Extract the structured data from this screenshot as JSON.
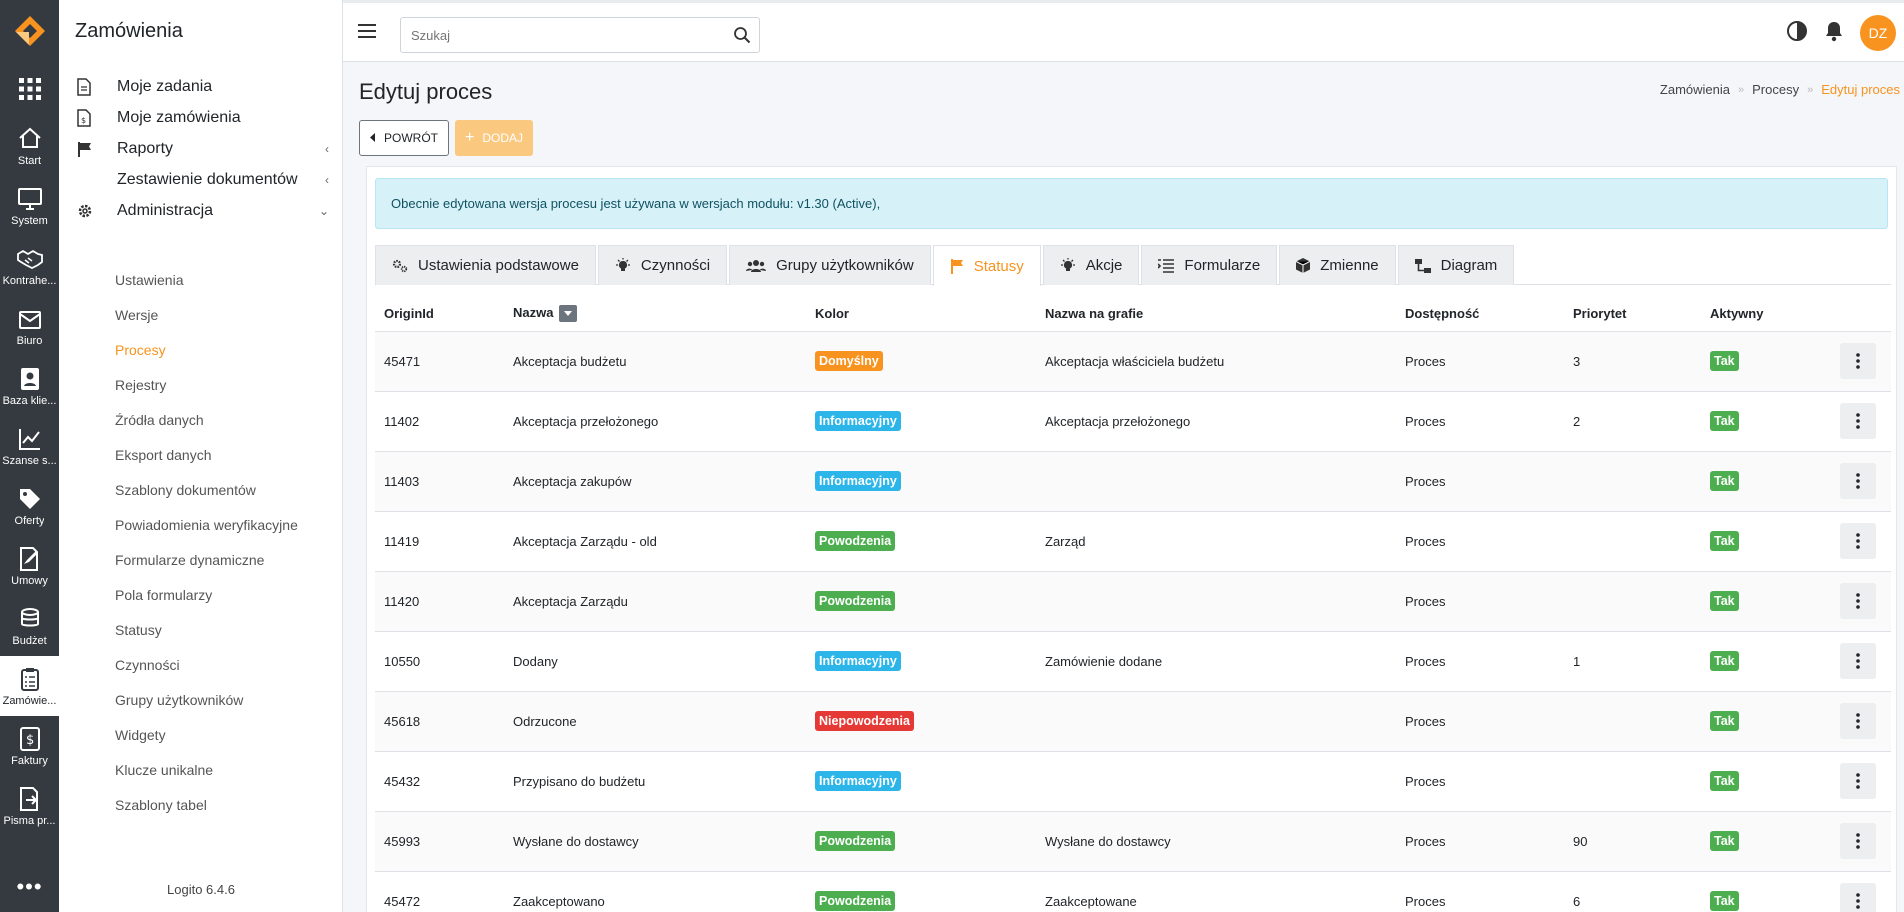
{
  "rail": {
    "items": [
      {
        "label": "Start",
        "icon": "home-icon"
      },
      {
        "label": "System",
        "icon": "monitor-icon"
      },
      {
        "label": "Kontrahe...",
        "icon": "handshake-icon"
      },
      {
        "label": "Biuro",
        "icon": "mail-icon"
      },
      {
        "label": "Baza klie...",
        "icon": "contact-icon"
      },
      {
        "label": "Szanse s...",
        "icon": "chart-line-icon"
      },
      {
        "label": "Oferty",
        "icon": "tag-icon"
      },
      {
        "label": "Umowy",
        "icon": "contract-icon"
      },
      {
        "label": "Budżet",
        "icon": "coins-icon"
      },
      {
        "label": "Zamówie...",
        "icon": "clipboard-icon"
      },
      {
        "label": "Faktury",
        "icon": "invoice-icon"
      },
      {
        "label": "Pisma pr...",
        "icon": "letter-icon"
      }
    ],
    "more": "•••"
  },
  "sidemenu": {
    "title": "Zamówienia",
    "main_items": [
      "Moje zadania",
      "Moje zamówienia",
      "Raporty",
      "Zestawienie dokumentów",
      "Administracja"
    ],
    "sub_items": [
      "Ustawienia",
      "Wersje",
      "Procesy",
      "Rejestry",
      "Źródła danych",
      "Eksport danych",
      "Szablony dokumentów",
      "Powiadomienia weryfikacyjne",
      "Formularze dynamiczne",
      "Pola formularzy",
      "Statusy",
      "Czynności",
      "Grupy użytkowników",
      "Widgety",
      "Klucze unikalne",
      "Szablony tabel"
    ],
    "version": "Logito 6.4.6"
  },
  "topbar": {
    "search_placeholder": "Szukaj",
    "avatar": "DZ"
  },
  "page": {
    "title": "Edytuj proces",
    "breadcrumb": [
      "Zamówienia",
      "Procesy",
      "Edytuj proces"
    ],
    "back_label": "POWRÓT",
    "add_label": "DODAJ",
    "alert": "Obecnie edytowana wersja procesu jest używana w wersjach modułu: v1.30 (Active),"
  },
  "tabs": [
    "Ustawienia podstawowe",
    "Czynności",
    "Grupy użytkowników",
    "Statusy",
    "Akcje",
    "Formularze",
    "Zmienne",
    "Diagram"
  ],
  "table": {
    "columns": [
      "OriginId",
      "Nazwa",
      "Kolor",
      "Nazwa na grafie",
      "Dostępność",
      "Priorytet",
      "Aktywny"
    ],
    "rows": [
      {
        "id": "45471",
        "name": "Akceptacja budżetu",
        "color": "Domyślny",
        "graph": "Akceptacja właściciela budżetu",
        "avail": "Proces",
        "prio": "3",
        "active": "Tak"
      },
      {
        "id": "11402",
        "name": "Akceptacja przełożonego",
        "color": "Informacyjny",
        "graph": "Akceptacja przełożonego",
        "avail": "Proces",
        "prio": "2",
        "active": "Tak"
      },
      {
        "id": "11403",
        "name": "Akceptacja zakupów",
        "color": "Informacyjny",
        "graph": "",
        "avail": "Proces",
        "prio": "",
        "active": "Tak"
      },
      {
        "id": "11419",
        "name": "Akceptacja Zarządu - old",
        "color": "Powodzenia",
        "graph": "Zarząd",
        "avail": "Proces",
        "prio": "",
        "active": "Tak"
      },
      {
        "id": "11420",
        "name": "Akceptacja Zarządu",
        "color": "Powodzenia",
        "graph": "",
        "avail": "Proces",
        "prio": "",
        "active": "Tak"
      },
      {
        "id": "10550",
        "name": "Dodany",
        "color": "Informacyjny",
        "graph": "Zamówienie dodane",
        "avail": "Proces",
        "prio": "1",
        "active": "Tak"
      },
      {
        "id": "45618",
        "name": "Odrzucone",
        "color": "Niepowodzenia",
        "graph": "",
        "avail": "Proces",
        "prio": "",
        "active": "Tak"
      },
      {
        "id": "45432",
        "name": "Przypisano do budżetu",
        "color": "Informacyjny",
        "graph": "",
        "avail": "Proces",
        "prio": "",
        "active": "Tak"
      },
      {
        "id": "45993",
        "name": "Wysłane do dostawcy",
        "color": "Powodzenia",
        "graph": "Wysłane do dostawcy",
        "avail": "Proces",
        "prio": "90",
        "active": "Tak"
      },
      {
        "id": "45472",
        "name": "Zaakceptowano",
        "color": "Powodzenia",
        "graph": "Zaakceptowane",
        "avail": "Proces",
        "prio": "6",
        "active": "Tak"
      }
    ]
  },
  "colors": {
    "accent": "#f7931e",
    "Domyślny": "#f7931e",
    "Informacyjny": "#2bb5e8",
    "Powodzenia": "#4cae4f",
    "Niepowodzenia": "#e53935",
    "Tak": "#4cae4f"
  }
}
